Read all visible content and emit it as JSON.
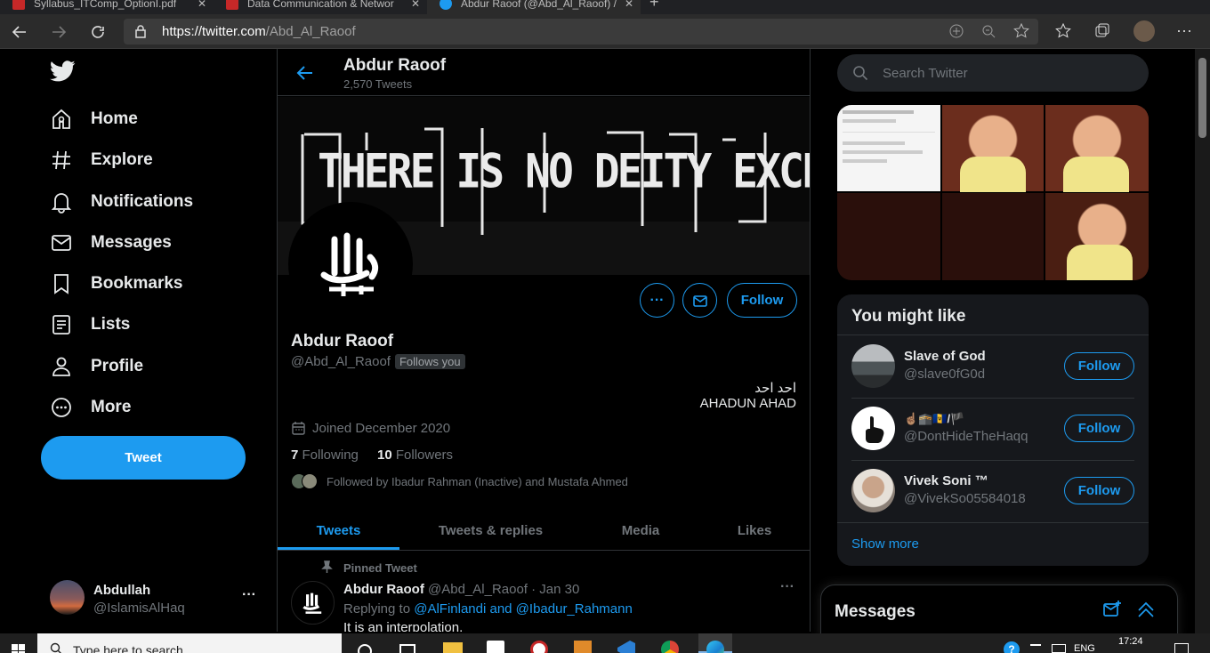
{
  "browser": {
    "tabs": [
      {
        "title": "Syllabus_ITComp_OptionI.pdf"
      },
      {
        "title": "Data Communication & Networ"
      },
      {
        "title": "Abdur Raoof (@Abd_Al_Raoof) /"
      }
    ],
    "url_prefix": "https://twitter.com",
    "url_path": "/Abd_Al_Raoof"
  },
  "sidebar": {
    "items": [
      {
        "label": "Home",
        "icon": "home-icon"
      },
      {
        "label": "Explore",
        "icon": "hashtag-icon"
      },
      {
        "label": "Notifications",
        "icon": "bell-icon"
      },
      {
        "label": "Messages",
        "icon": "envelope-icon"
      },
      {
        "label": "Bookmarks",
        "icon": "bookmark-icon"
      },
      {
        "label": "Lists",
        "icon": "list-icon"
      },
      {
        "label": "Profile",
        "icon": "person-icon"
      },
      {
        "label": "More",
        "icon": "more-circle-icon"
      }
    ],
    "tweet_label": "Tweet",
    "account": {
      "name": "Abdullah",
      "handle": "@IslamisAlHaq",
      "more": "···"
    }
  },
  "header": {
    "title": "Abdur Raoof",
    "subtitle": "2,570 Tweets"
  },
  "banner": {
    "text": "THERE IS NO DEITY EXCEPT GOD"
  },
  "profile": {
    "name": "Abdur Raoof",
    "handle": "@Abd_Al_Raoof",
    "follows_you": "Follows you",
    "bio_line1": "احد احد",
    "bio_line2": "AHADUN AHAD",
    "joined": "Joined December 2020",
    "following_count": "7",
    "following_label": "Following",
    "followers_count": "10",
    "followers_label": "Followers",
    "followed_by": "Followed by Ibadur Rahman (Inactive) and Mustafa Ahmed",
    "follow_label": "Follow",
    "more_label": "···"
  },
  "tabs": [
    {
      "label": "Tweets"
    },
    {
      "label": "Tweets & replies"
    },
    {
      "label": "Media"
    },
    {
      "label": "Likes"
    }
  ],
  "pinned": {
    "label": "Pinned Tweet",
    "author": "Abdur Raoof",
    "handle": "@Abd_Al_Raoof",
    "date": "· Jan 30",
    "replying_prefix": "Replying to",
    "replying_users": "@AlFinlandi and @Ibadur_Rahmann",
    "text": "It is an interpolation.",
    "more": "···"
  },
  "search": {
    "placeholder": "Search Twitter"
  },
  "who_to_follow": {
    "title": "You might like",
    "users": [
      {
        "name": "Slave of God",
        "handle": "@slave0fG0d",
        "follow": "Follow"
      },
      {
        "name": "☝🏽🕋🇧🇧/🏴",
        "handle": "@DontHideTheHaqq",
        "follow": "Follow"
      },
      {
        "name": "Vivek Soni ™",
        "handle": "@VivekSo05584018",
        "follow": "Follow"
      }
    ],
    "show_more": "Show more"
  },
  "messages_drawer": {
    "title": "Messages"
  },
  "taskbar": {
    "search_placeholder": "Type here to search",
    "lang": "ENG",
    "time": "17:24"
  },
  "colors": {
    "accent": "#1d9bf0",
    "background": "#000000",
    "card": "#16181c",
    "border": "#2f3336",
    "muted": "#71767b"
  }
}
